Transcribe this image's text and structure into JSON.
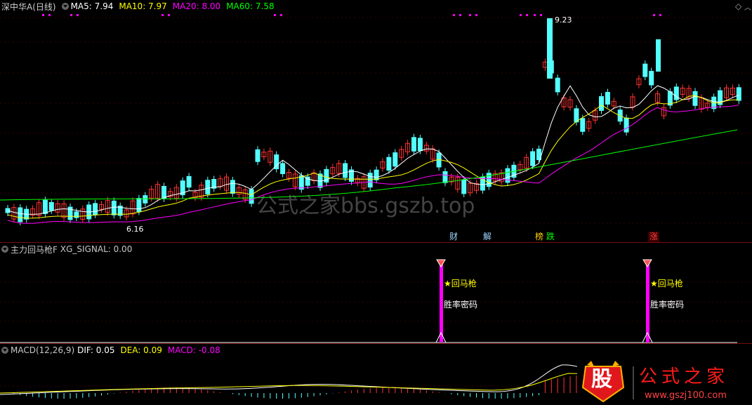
{
  "price_panel": {
    "title": "深中华A(日线)",
    "ma": [
      {
        "label": "MA5: 7.94",
        "color": "#ffffff"
      },
      {
        "label": "MA10: 7.97",
        "color": "#ffff00"
      },
      {
        "label": "MA20: 8.00",
        "color": "#ff00ff"
      },
      {
        "label": "MA60: 7.58",
        "color": "#00ff00"
      }
    ],
    "high_label": "9.23",
    "low_label": "6.16",
    "watermark": "公式之家bbs.gszb.top",
    "event_tags": [
      {
        "text": "财",
        "color": "#9fd6ff"
      },
      {
        "text": "解",
        "color": "#9fd6ff"
      },
      {
        "text": "榜",
        "color": "#ffd000"
      },
      {
        "text": "跌",
        "color": "#00ff00"
      },
      {
        "text": "涨",
        "color": "#ff4040"
      }
    ],
    "colors": {
      "up": "#ff3232",
      "down": "#54ffff",
      "ma5": "#ffffff",
      "ma10": "#ffff00",
      "ma20": "#ff00ff",
      "ma60": "#00ff00"
    }
  },
  "signal_panel": {
    "title": "主力回马枪F",
    "value_label": "XG_SIGNAL: 0.00",
    "signals": [
      {
        "label": "★回马枪",
        "sub": "胜率密码"
      },
      {
        "label": "★回马枪",
        "sub": "胜率密码"
      }
    ],
    "color": "#ff00ff"
  },
  "macd_panel": {
    "title": "MACD(12,26,9)",
    "dif_label": "DIF: 0.05",
    "dea_label": "DEA: 0.09",
    "macd_label": "MACD: -0.08",
    "dif_color": "#ffffff",
    "dea_color": "#ffff00",
    "macd_color": "#ff00ff"
  },
  "logo": {
    "badge": "股",
    "text": "公式之家",
    "url": "www.gszj100.com"
  }
}
